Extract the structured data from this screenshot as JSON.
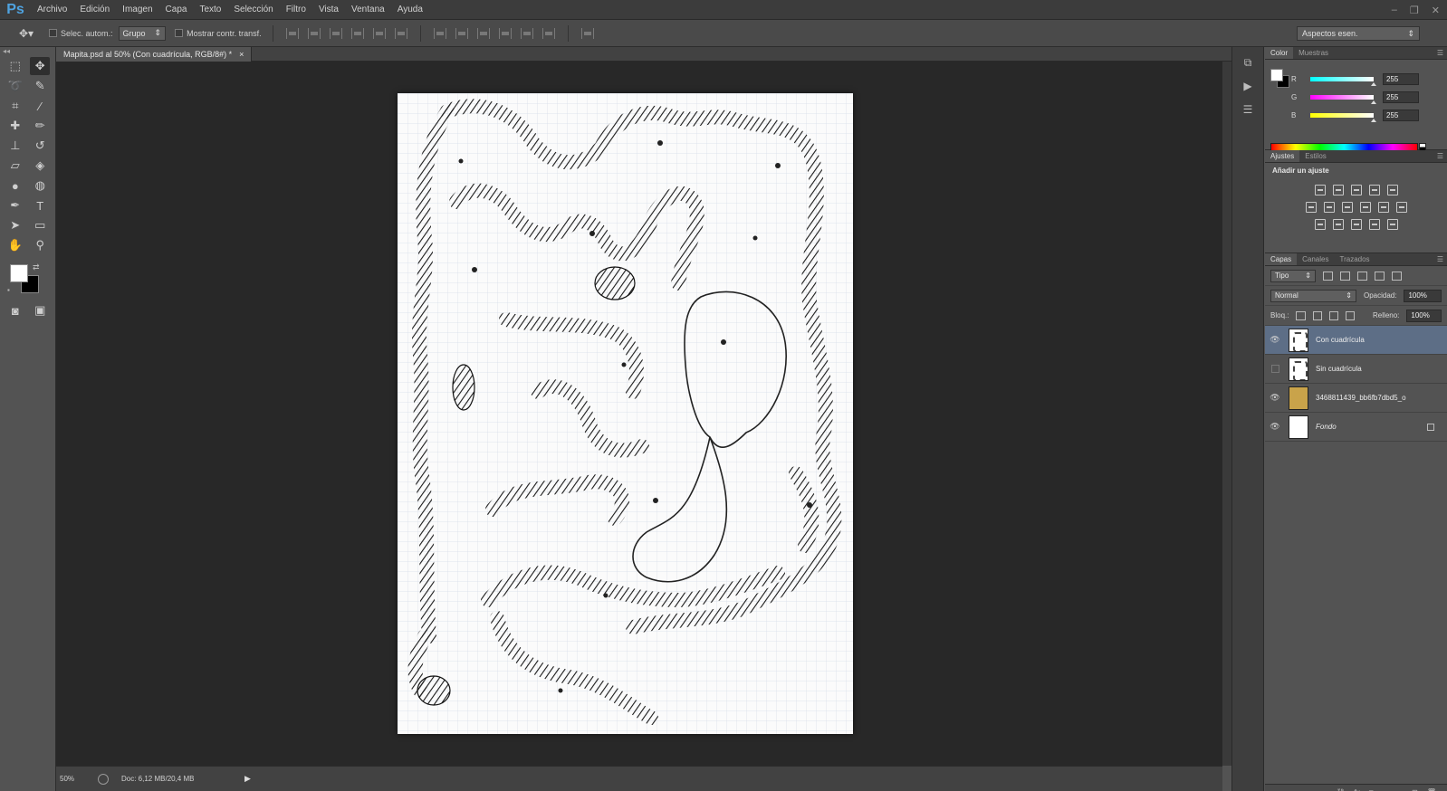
{
  "app": {
    "logo": "Ps"
  },
  "menu": [
    "Archivo",
    "Edición",
    "Imagen",
    "Capa",
    "Texto",
    "Selección",
    "Filtro",
    "Vista",
    "Ventana",
    "Ayuda"
  ],
  "options": {
    "auto_select_label": "Selec. autom.:",
    "auto_select_mode": "Grupo",
    "transform_label": "Mostrar contr. transf.",
    "workspace": "Aspectos esen."
  },
  "document": {
    "tab_title": "Mapita.psd al 50% (Con cuadrícula, RGB/8#) *",
    "close": "×"
  },
  "status": {
    "zoom": "50%",
    "doc_info": "Doc: 6,12 MB/20,4 MB",
    "arrow": "▶"
  },
  "color_panel": {
    "tabs": [
      "Color",
      "Muestras"
    ],
    "channels": [
      {
        "label": "R",
        "value": "255",
        "color": "#ff0000"
      },
      {
        "label": "G",
        "value": "255",
        "color": "#00ff00"
      },
      {
        "label": "B",
        "value": "255",
        "color": "#0000ff"
      }
    ]
  },
  "adjust_panel": {
    "tabs": [
      "Ajustes",
      "Estilos"
    ],
    "title": "Añadir un ajuste"
  },
  "layers_panel": {
    "tabs": [
      "Capas",
      "Canales",
      "Trazados"
    ],
    "filter": "Tipo",
    "blend_mode": "Normal",
    "opacity_label": "Opacidad:",
    "opacity": "100%",
    "lock_label": "Bloq.:",
    "fill_label": "Relleno:",
    "fill": "100%",
    "layers": [
      {
        "name": "Con cuadrícula",
        "visible": true,
        "selected": true
      },
      {
        "name": "Sin cuadrícula",
        "visible": false,
        "selected": false
      },
      {
        "name": "3468811439_bb6fb7dbd5_o",
        "visible": true,
        "selected": false
      },
      {
        "name": "Fondo",
        "visible": true,
        "selected": false,
        "locked": true
      }
    ]
  },
  "colors": {
    "selection": "#5d6e86",
    "menubar": "#3c3c3c",
    "canvas_bg": "#282828"
  }
}
